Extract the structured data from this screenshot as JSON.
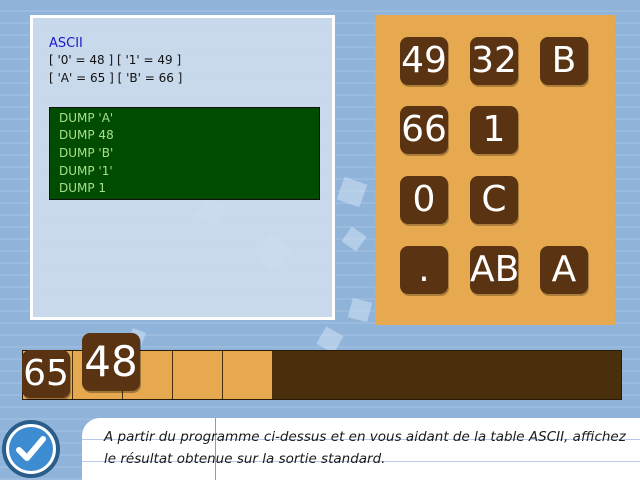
{
  "code": {
    "title": "ASCII",
    "line1": "[ '0' = 48 ] [ '1' = 49 ]",
    "line2": "[ 'A' = 65 ] [ 'B' = 66 ]",
    "dump": [
      "DUMP 'A'",
      "DUMP 48",
      "DUMP 'B'",
      "DUMP '1'",
      "DUMP 1"
    ]
  },
  "tiles": [
    "49",
    "32",
    "B",
    "66",
    "1",
    "0",
    "C",
    ".",
    "AB",
    "A"
  ],
  "answer": {
    "placed": [
      "65",
      "48"
    ],
    "slot_count": 5
  },
  "instruction": "A partir du programme ci-dessus et en vous aidant de la table ASCII, affichez le résultat obtenue sur la sortie standard.",
  "validate_icon": "checkmark-icon",
  "colors": {
    "tile": "#5a3312",
    "board": "#e6a94f",
    "dump_bg": "#004c00",
    "dump_text": "#a8e08a",
    "title": "#1a1acc",
    "validate": "#3d8bd0"
  }
}
